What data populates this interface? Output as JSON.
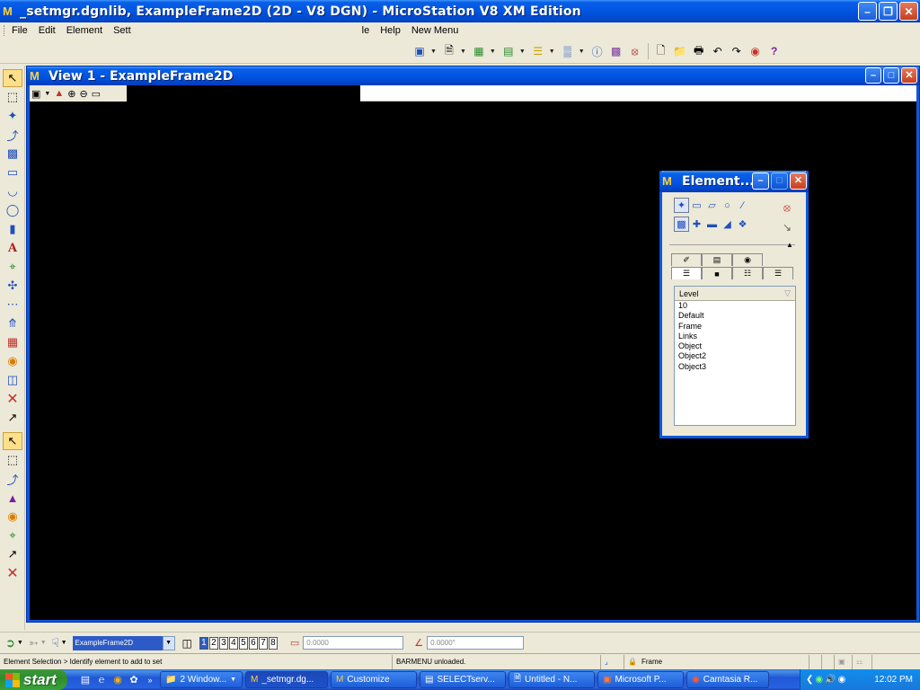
{
  "app": {
    "title": "_setmgr.dgnlib, ExampleFrame2D (2D - V8 DGN) - MicroStation V8 XM Edition"
  },
  "menubar": {
    "items": [
      "File",
      "Edit",
      "Element",
      "Sett",
      "le",
      "Help",
      "New Menu"
    ]
  },
  "view_window": {
    "title": "View 1 - ExampleFrame2D"
  },
  "element_dialog": {
    "title": "Element...",
    "level_header": "Level",
    "levels": [
      "10",
      "Default",
      "Frame",
      "Links",
      "Object",
      "Object2",
      "Object3"
    ]
  },
  "bottom_toolbar": {
    "model_name": "ExampleFrame2D",
    "view_numbers": [
      "1",
      "2",
      "3",
      "4",
      "5",
      "6",
      "7",
      "8"
    ],
    "active_view": "1",
    "coord_value": "0.0000",
    "angle_value": "0.0000°"
  },
  "statusbar": {
    "prompt": "Element Selection > Identify element to add to set",
    "message": "BARMENU unloaded.",
    "active_level": "Frame"
  },
  "taskbar": {
    "start_label": "start",
    "tasks": [
      "2 Window...",
      "_setmgr.dg...",
      "Customize",
      "SELECTserv...",
      "Untitled - N...",
      "Microsoft P...",
      "Camtasia R..."
    ],
    "clock": "12:02 PM"
  },
  "colors": {
    "xp_blue": "#0054e3",
    "canvas": "#000000",
    "taskbar_green": "#3c9a3c"
  }
}
